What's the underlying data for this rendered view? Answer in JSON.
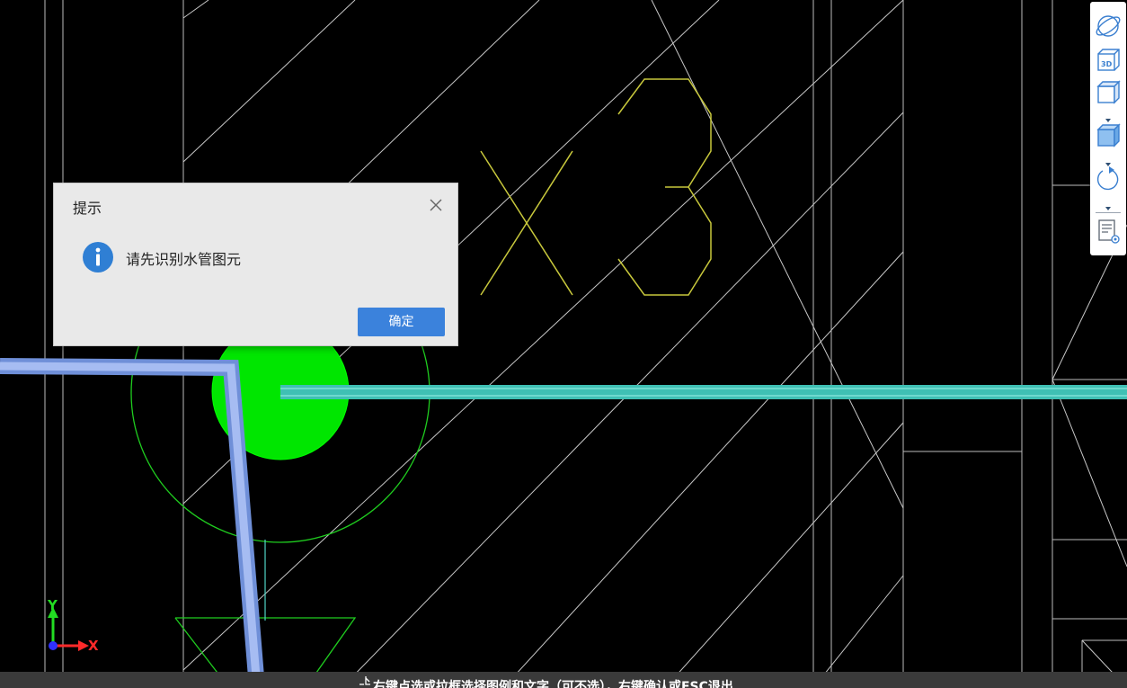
{
  "dialog": {
    "title": "提示",
    "message": "请先识别水管图元",
    "ok_label": "确定",
    "icon": "info-icon"
  },
  "axes": {
    "x_label": "X",
    "y_label": "Y"
  },
  "canvas": {
    "annotation_text": "X3",
    "colors": {
      "background": "#000000",
      "grid_lines": "#bdbdbd",
      "annotation": "#c8c83c",
      "pipe_blue": "#8ea6e8",
      "pipe_cyan": "#4fd6c8",
      "fixture_green": "#00e600",
      "outline_green": "#1fcc1f"
    }
  },
  "toolbar": {
    "items": [
      {
        "name": "orbit-icon"
      },
      {
        "name": "3d-view-icon"
      },
      {
        "name": "view-cube-icon"
      },
      {
        "name": "display-mode-icon"
      },
      {
        "name": "rotate-icon"
      },
      {
        "name": "properties-view-icon"
      }
    ]
  },
  "status_bar": {
    "text": "右键点选或拉框选择图例和文字（可不选），右键确认或ESC退出"
  }
}
